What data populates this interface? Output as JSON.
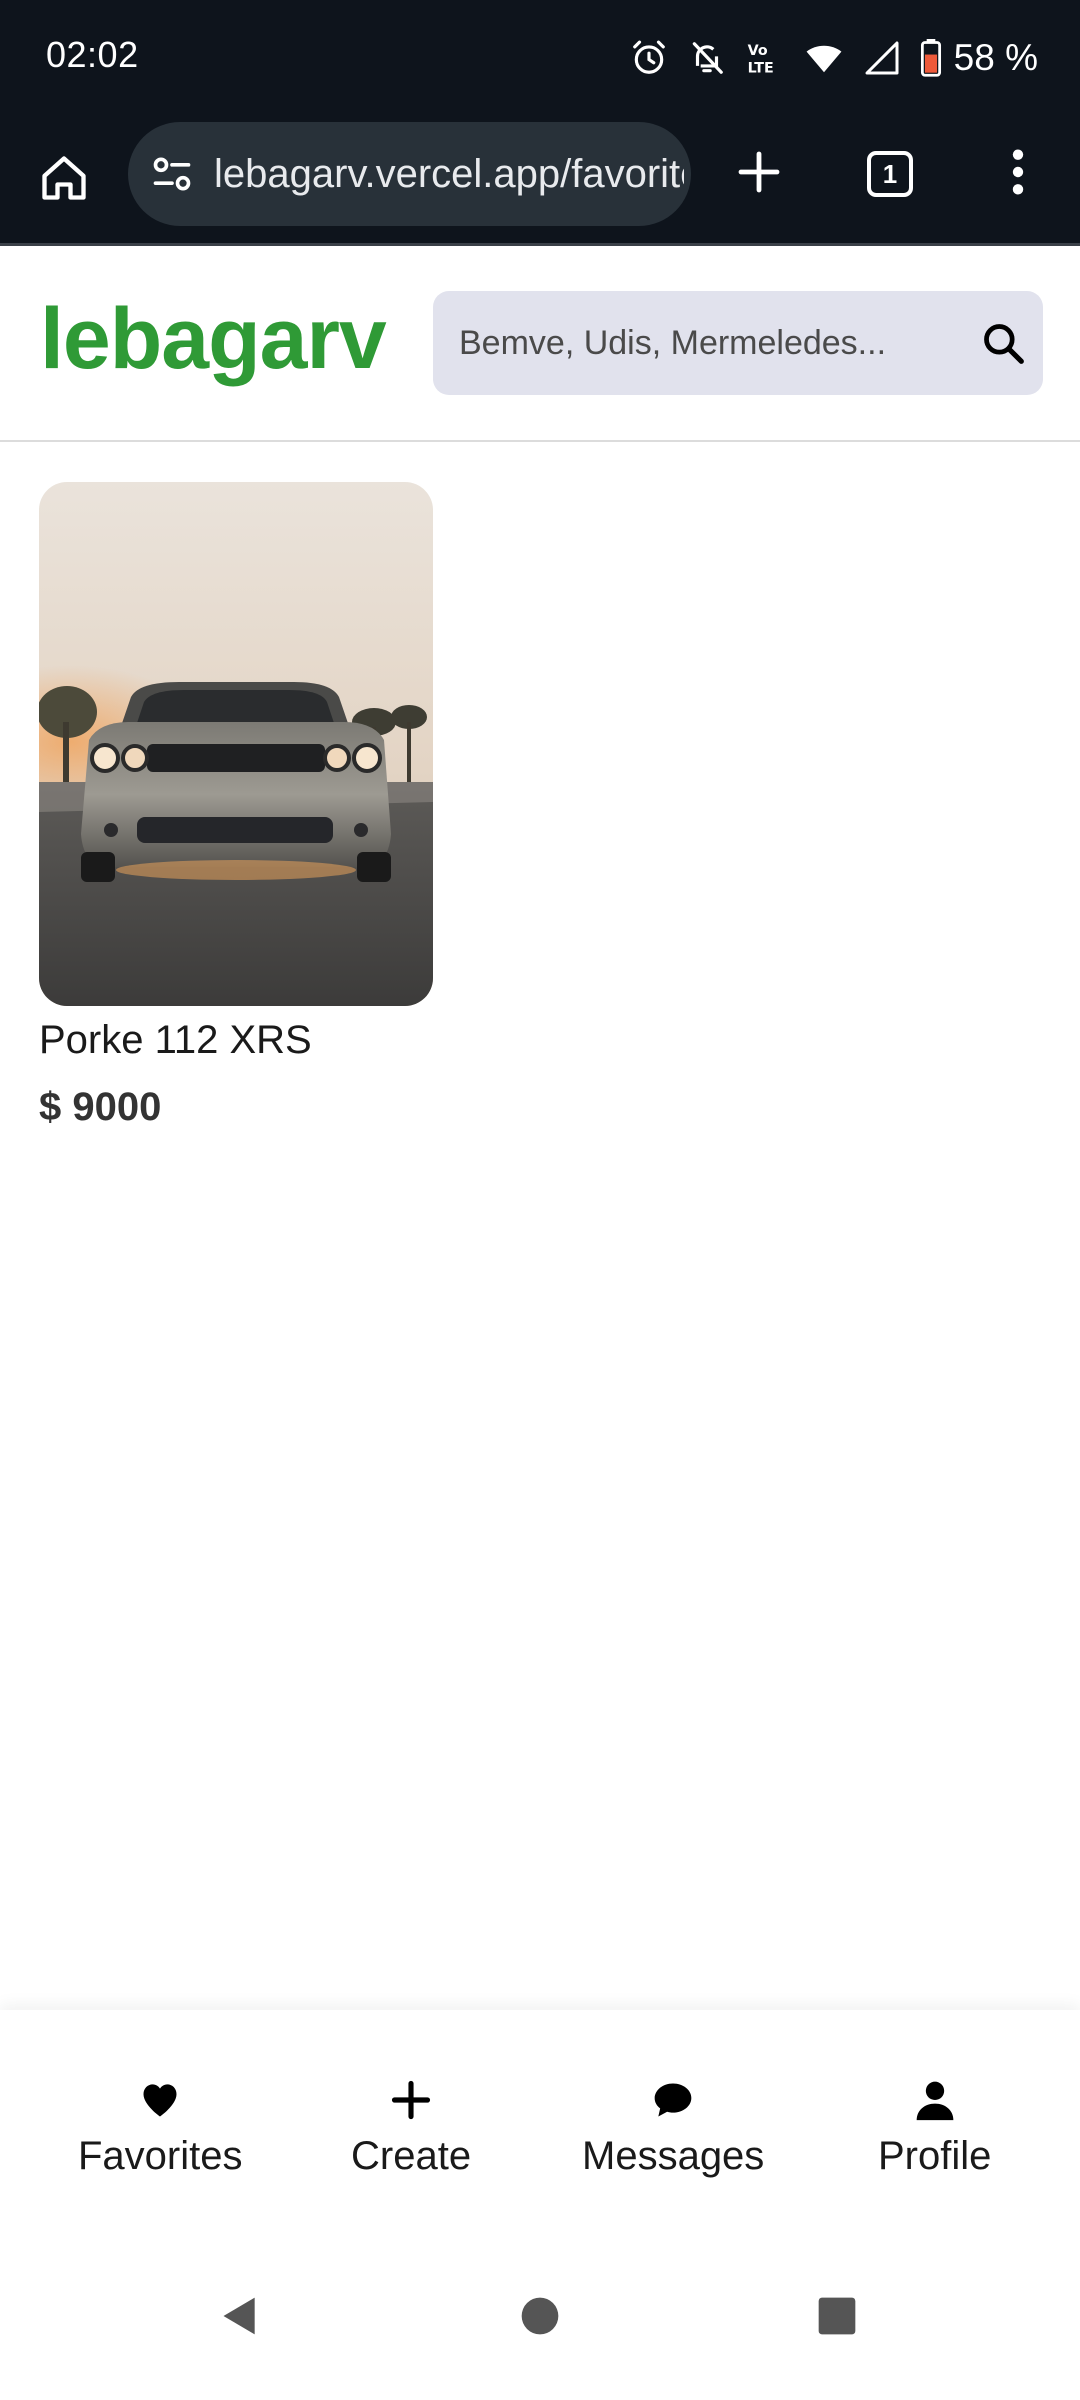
{
  "status_bar": {
    "time": "02:02",
    "battery": "58 %",
    "icons": [
      "alarm-icon",
      "bell-off-icon",
      "volte-icon",
      "wifi-icon",
      "signal-icon",
      "battery-icon"
    ]
  },
  "browser": {
    "url": "lebagarv.vercel.app/favorites",
    "tab_count": "1",
    "icons": [
      "home-icon",
      "site-settings-icon",
      "plus-icon",
      "tabs-icon",
      "more-vert-icon"
    ]
  },
  "header": {
    "logo": "lebagarv",
    "logo_color": "#2f9a36",
    "search_placeholder": "Bemve, Udis, Mermeledes..."
  },
  "favorites": [
    {
      "title": "Porke 112 XRS",
      "price": "$ 9000"
    }
  ],
  "bottom_nav": {
    "items": [
      {
        "label": "Favorites",
        "icon": "heart-icon"
      },
      {
        "label": "Create",
        "icon": "plus-icon"
      },
      {
        "label": "Messages",
        "icon": "chat-bubble-icon"
      },
      {
        "label": "Profile",
        "icon": "person-icon"
      }
    ]
  },
  "system_nav": {
    "icons": [
      "back-icon",
      "home-circle-icon",
      "recents-square-icon"
    ]
  }
}
